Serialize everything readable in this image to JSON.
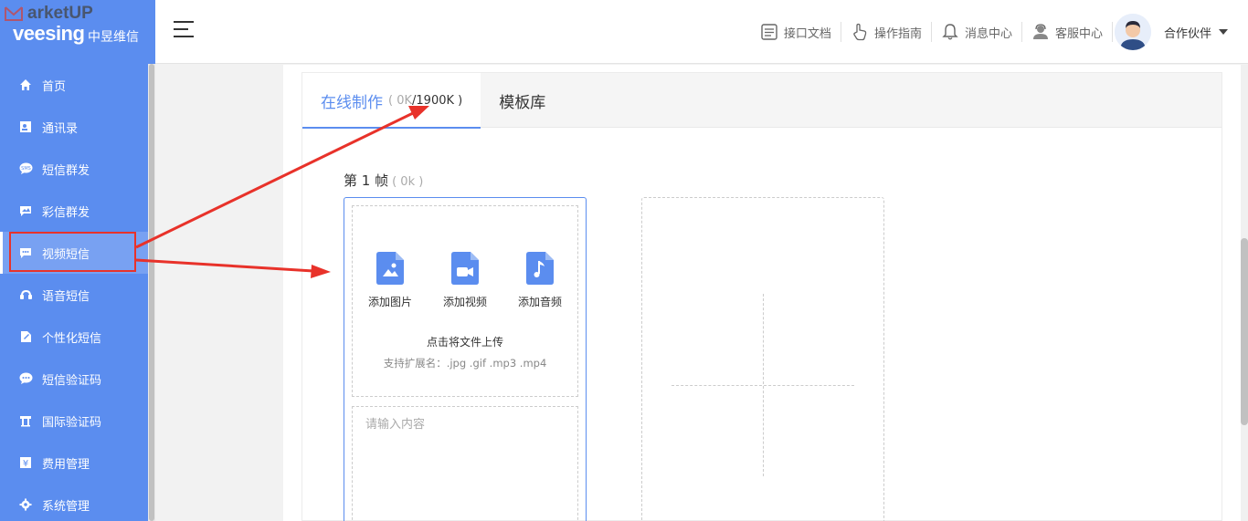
{
  "watermark": {
    "text": "arketUP"
  },
  "brand": {
    "logo_text": "veesing",
    "logo_cn": "中昱维信"
  },
  "sidebar": {
    "items": [
      {
        "label": "首页",
        "icon": "home-icon"
      },
      {
        "label": "通讯录",
        "icon": "contacts-icon"
      },
      {
        "label": "短信群发",
        "icon": "sms-icon"
      },
      {
        "label": "彩信群发",
        "icon": "image-message-icon"
      },
      {
        "label": "视频短信",
        "icon": "video-message-icon",
        "active": true
      },
      {
        "label": "语音短信",
        "icon": "voice-icon"
      },
      {
        "label": "个性化短信",
        "icon": "custom-icon"
      },
      {
        "label": "短信验证码",
        "icon": "verify-icon"
      },
      {
        "label": "国际验证码",
        "icon": "international-icon"
      },
      {
        "label": "费用管理",
        "icon": "yen-icon"
      },
      {
        "label": "系统管理",
        "icon": "settings-icon"
      }
    ]
  },
  "header": {
    "links": [
      {
        "label": "接口文档",
        "icon": "api-doc-icon"
      },
      {
        "label": "操作指南",
        "icon": "hand-pointer-icon"
      },
      {
        "label": "消息中心",
        "icon": "bell-icon"
      },
      {
        "label": "客服中心",
        "icon": "customer-service-icon"
      }
    ],
    "user_name": "合作伙伴"
  },
  "tabs": [
    {
      "label": "在线制作",
      "counter_open": "(",
      "counter_used": "0K",
      "counter_total": "/1900K",
      "counter_close": ")",
      "active": true
    },
    {
      "label": "模板库",
      "active": false
    }
  ],
  "frame": {
    "title": "第 1 帧",
    "size": "( 0k )",
    "buttons": [
      {
        "label": "添加图片",
        "icon": "image-file-icon"
      },
      {
        "label": "添加视频",
        "icon": "video-file-icon"
      },
      {
        "label": "添加音频",
        "icon": "audio-file-icon"
      }
    ],
    "upload_tip": "点击将文件上传",
    "upload_ext": "支持扩展名：.jpg .gif .mp3 .mp4",
    "text_placeholder": "请输入内容"
  },
  "colors": {
    "sidebar": "#5b8def",
    "accent": "#5b8def",
    "annotation": "#e8322a"
  }
}
